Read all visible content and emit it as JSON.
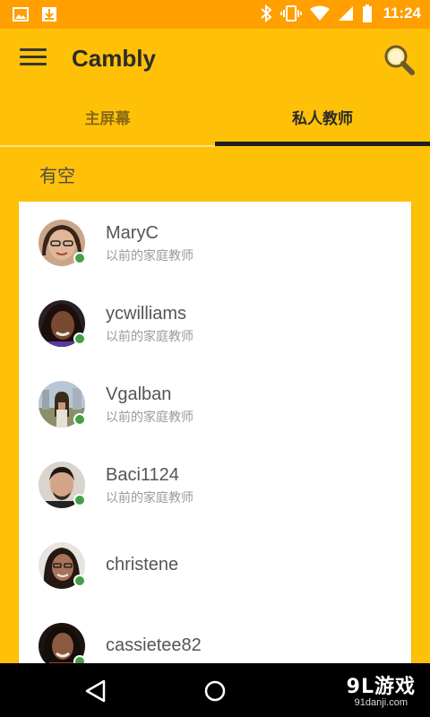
{
  "status_bar": {
    "time": "11:24",
    "icons": [
      "image-icon",
      "download-icon",
      "bluetooth-icon",
      "vibrate-icon",
      "wifi-icon",
      "signal-icon",
      "battery-icon"
    ]
  },
  "app_bar": {
    "title": "Cambly",
    "menu_icon": "hamburger-menu-icon",
    "search_icon": "search-icon"
  },
  "tabs": [
    {
      "label": "主屏幕",
      "selected": false
    },
    {
      "label": "私人教师",
      "selected": true
    }
  ],
  "section": {
    "title": "有空"
  },
  "tutors": [
    {
      "name": "MaryC",
      "subtitle": "以前的家庭教师",
      "online": true
    },
    {
      "name": "ycwilliams",
      "subtitle": "以前的家庭教师",
      "online": true
    },
    {
      "name": "Vgalban",
      "subtitle": "以前的家庭教师",
      "online": true
    },
    {
      "name": "Baci1124",
      "subtitle": "以前的家庭教师",
      "online": true
    },
    {
      "name": "christene",
      "subtitle": "",
      "online": true
    },
    {
      "name": "cassietee82",
      "subtitle": "",
      "online": true
    }
  ],
  "watermark": {
    "main": "9L游戏",
    "sub": "91danji.com"
  },
  "colors": {
    "accent": "#FFC107",
    "status_bar": "#FF9F00",
    "online": "#43A047",
    "nav_bar": "#000000"
  }
}
